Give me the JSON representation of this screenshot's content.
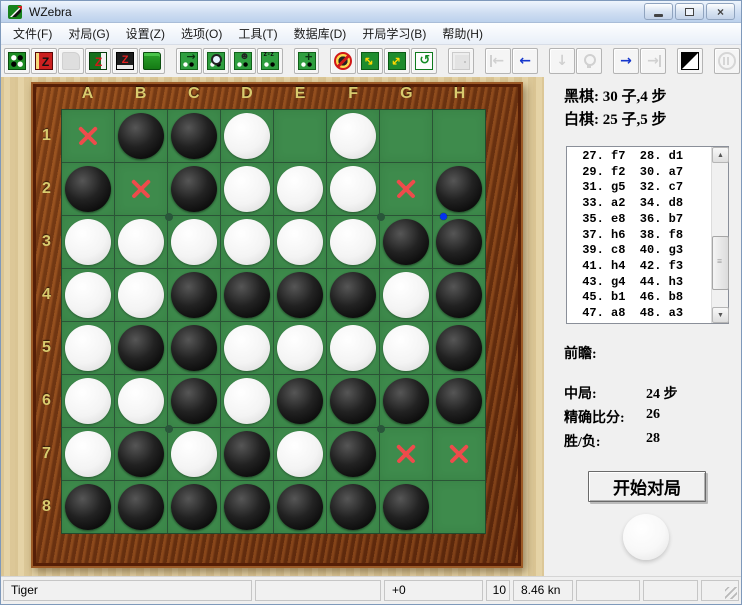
{
  "window": {
    "title": "WZebra"
  },
  "menu": {
    "items": [
      "文件(F)",
      "对局(G)",
      "设置(Z)",
      "选项(O)",
      "工具(T)",
      "数据库(D)",
      "开局学习(B)",
      "帮助(H)"
    ]
  },
  "toolbar": {
    "buttons": [
      {
        "name": "new-game-icon",
        "enabled": true
      },
      {
        "name": "open-book-icon",
        "enabled": true
      },
      {
        "name": "save-disabled-icon",
        "enabled": false
      },
      {
        "name": "edit-book-icon",
        "enabled": true
      },
      {
        "name": "save-book-icon",
        "enabled": true
      },
      {
        "name": "open-folder-icon",
        "enabled": true
      },
      {
        "name": "play-move-icon",
        "enabled": true,
        "gap": true
      },
      {
        "name": "analyze-board-icon",
        "enabled": true
      },
      {
        "name": "practice-icon",
        "enabled": true
      },
      {
        "name": "zebra-play-icon",
        "enabled": true
      },
      {
        "name": "add-position-icon",
        "enabled": true,
        "gap": true
      },
      {
        "name": "stop-eval-icon",
        "enabled": true,
        "gap": true
      },
      {
        "name": "swap-disks-icon",
        "enabled": true
      },
      {
        "name": "resize-board-icon",
        "enabled": true
      },
      {
        "name": "rotate-board-icon",
        "enabled": true
      },
      {
        "name": "exit-icon",
        "enabled": false,
        "gap": true
      },
      {
        "name": "first-move-icon",
        "enabled": false,
        "gap": true
      },
      {
        "name": "prev-move-icon",
        "enabled": true
      },
      {
        "name": "move-down-icon",
        "enabled": false,
        "gap": true
      },
      {
        "name": "hint-icon",
        "enabled": false
      },
      {
        "name": "next-move-icon",
        "enabled": true,
        "gap": true
      },
      {
        "name": "last-move-icon",
        "enabled": false
      },
      {
        "name": "invert-colors-icon",
        "enabled": true,
        "gap": true
      },
      {
        "name": "pause-icon",
        "enabled": false,
        "gap": true
      }
    ]
  },
  "board": {
    "columns": [
      "A",
      "B",
      "C",
      "D",
      "E",
      "F",
      "G",
      "H"
    ],
    "rows": [
      "1",
      "2",
      "3",
      "4",
      "5",
      "6",
      "7",
      "8"
    ],
    "legend": {
      "B": "black disc",
      "W": "white disc",
      "X": "legal move marker",
      "": "empty"
    },
    "grid": [
      [
        "X",
        "B",
        "B",
        "W",
        "",
        "W",
        "",
        ""
      ],
      [
        "B",
        "X",
        "B",
        "W",
        "W",
        "W",
        "X",
        "B"
      ],
      [
        "W",
        "W",
        "W",
        "W",
        "W",
        "W",
        "B",
        "B"
      ],
      [
        "W",
        "W",
        "B",
        "B",
        "B",
        "B",
        "W",
        "B"
      ],
      [
        "W",
        "B",
        "B",
        "W",
        "W",
        "W",
        "W",
        "B"
      ],
      [
        "W",
        "W",
        "B",
        "W",
        "B",
        "B",
        "B",
        "B"
      ],
      [
        "W",
        "B",
        "W",
        "B",
        "W",
        "B",
        "X",
        "X"
      ],
      [
        "B",
        "B",
        "B",
        "B",
        "B",
        "B",
        "B",
        ""
      ]
    ],
    "blue_dot_near": "H2"
  },
  "info": {
    "black": "黑棋: 30 子,4 步",
    "white": "白棋: 25 子,5 步"
  },
  "moves": {
    "lines": [
      " 27. f7  28. d1",
      " 29. f2  30. a7",
      " 31. g5  32. c7",
      " 33. a2  34. d8",
      " 35. e8  36. b7",
      " 37. h6  38. f8",
      " 39. c8  40. g3",
      " 41. h4  42. f3",
      " 43. g4  44. h3",
      " 45. b1  46. b8",
      " 47. a8  48. a3"
    ]
  },
  "analysis": {
    "lookahead_label": "前瞻:",
    "midgame_label": "中局:",
    "midgame_value": "24 步",
    "exact_label": "精确比分:",
    "exact_value": "26",
    "winloss_label": "胜/负:",
    "winloss_value": "28"
  },
  "actions": {
    "start_button": "开始对局",
    "turn": "white"
  },
  "statusbar": {
    "engine": "Tiger",
    "score": "+0",
    "depth": "10",
    "speed": "8.46 kn"
  },
  "colors": {
    "board_green": "#3e8b4c",
    "frame_wood": "#7a3a14",
    "marker_red": "#ee4b4b",
    "last_move_blue": "#0433ee",
    "label_gold": "#d9cb6e"
  }
}
